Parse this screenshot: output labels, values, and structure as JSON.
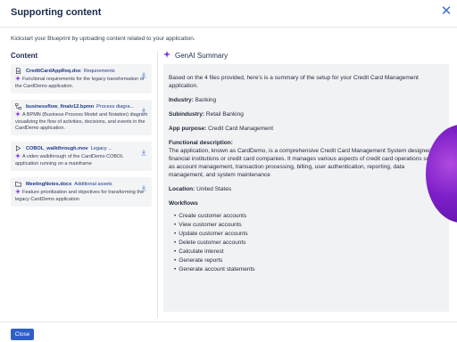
{
  "dialog": {
    "title": "Supporting content",
    "intro": "Kickstart your Blueprint by uploading content related to your application.",
    "close_label": "Close"
  },
  "left": {
    "heading": "Content",
    "files": [
      {
        "name": "CreditCardAppReq.doc",
        "type": "Requirements",
        "icon": "document-icon",
        "desc": "Functional requirements for the legacy transformation of the CardDemo application."
      },
      {
        "name": "businessflow_finalv12.bpmn",
        "type": "Process diagra...",
        "icon": "process-diagram-icon",
        "desc": "A BPMN (Business Process Model and Notation) diagram visualizing the flow of activities, decisions, and events in the CardDemo application."
      },
      {
        "name": "COBOL_walkthrough.mov",
        "type": "Legacy ...",
        "icon": "video-icon",
        "desc": "A video walkthrough of the CardDemo COBOL application running on a mainframe"
      },
      {
        "name": "MeetingNotes.docx",
        "type": "Additional assets",
        "icon": "folder-icon",
        "desc": "Feature prioritization and objectives for transforming the legacy CardDemo application"
      }
    ]
  },
  "right": {
    "heading": "GenAI Summary",
    "intro": "Based on the 4 files provided, here's is a summary of the setup for your Credit Card Management application.",
    "industry_label": "Industry:",
    "industry": "Banking",
    "subindustry_label": "Subindustry:",
    "subindustry": "Retail Banking",
    "purpose_label": "App purpose:",
    "purpose": "Credit Card Management",
    "func_label": "Functional description:",
    "func_desc": "The application, known as CardDemo, is a comprehensive Credit Card Management System designed for financial institutions or credit card companies. It manages various aspects of credit card operations such as account management, transaction processing, billing, user authentication, reporting, data management, and system maintenance",
    "location_label": "Location:",
    "location": "United States",
    "workflows_label": "Workflows",
    "workflows": [
      "Create customer accounts",
      "View customer accounts",
      "Update customer accounts",
      "Delete customer accounts",
      "Calculate interest",
      "Generate reports",
      "Generate account statements"
    ]
  },
  "colors": {
    "accent": "#2f5fc4",
    "title": "#1b2a4e",
    "spark": "#7b2ff0",
    "panel": "#f1f2f4"
  }
}
